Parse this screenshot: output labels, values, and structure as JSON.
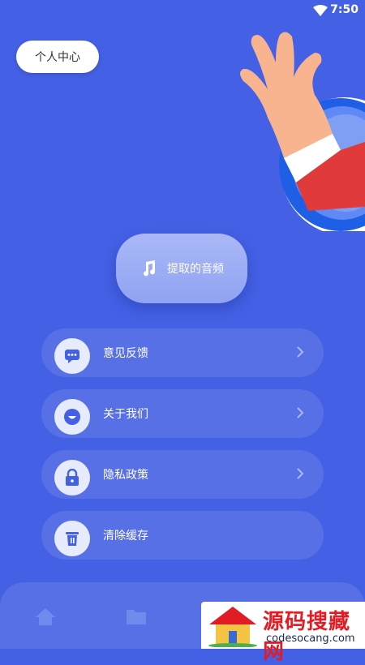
{
  "status": {
    "time": "7:50"
  },
  "header": {
    "profile_label": "个人中心"
  },
  "main": {
    "extract_label": "提取的音频"
  },
  "menu": [
    {
      "label": "意见反馈",
      "icon": "chat-icon",
      "has_chevron": true
    },
    {
      "label": "关于我们",
      "icon": "info-icon",
      "has_chevron": true
    },
    {
      "label": "隐私政策",
      "icon": "lock-icon",
      "has_chevron": true
    },
    {
      "label": "清除缓存",
      "icon": "trash-icon",
      "has_chevron": false
    }
  ],
  "bottom_nav": {
    "items": [
      "home-icon",
      "folder-icon"
    ]
  },
  "watermark": {
    "title": "源码搜藏网",
    "subtitle": "codesocang.com"
  },
  "colors": {
    "background": "#4460e4",
    "accent": "#4460e4"
  }
}
